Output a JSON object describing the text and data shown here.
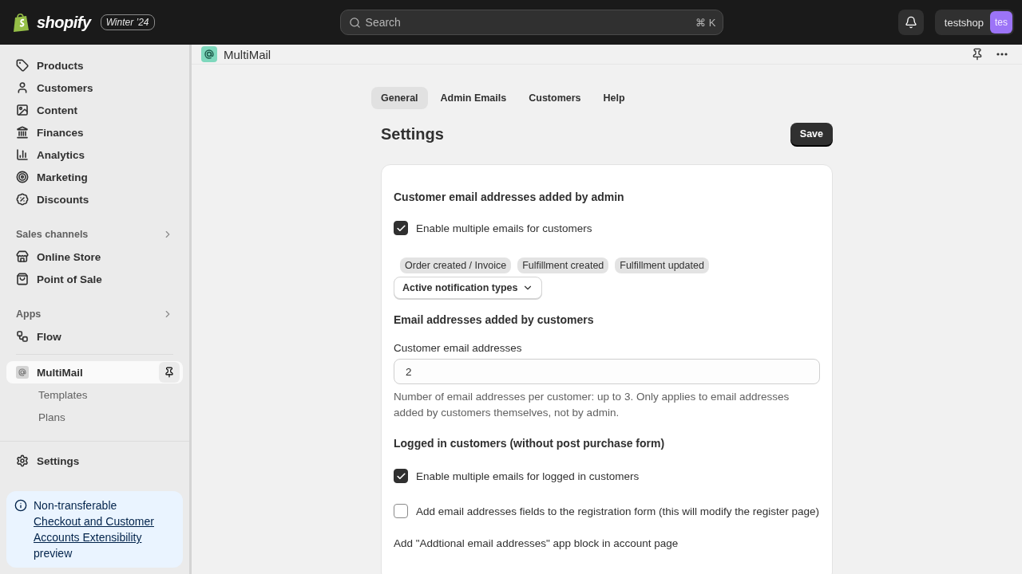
{
  "topbar": {
    "brand": "shopify",
    "edition": "Winter ’24",
    "search": {
      "placeholder": "Search",
      "shortcut": "⌘ K"
    },
    "store": {
      "name": "testshop",
      "avatar": "tes"
    }
  },
  "sidebar": {
    "nav_items": [
      {
        "label": "Products"
      },
      {
        "label": "Customers"
      },
      {
        "label": "Content"
      },
      {
        "label": "Finances"
      },
      {
        "label": "Analytics"
      },
      {
        "label": "Marketing"
      },
      {
        "label": "Discounts"
      }
    ],
    "sections": [
      {
        "title": "Sales channels",
        "items": [
          {
            "label": "Online Store"
          },
          {
            "label": "Point of Sale"
          }
        ]
      },
      {
        "title": "Apps",
        "items": [
          {
            "label": "Flow"
          }
        ]
      }
    ],
    "app": {
      "label": "MultiMail",
      "selected": true,
      "children": [
        {
          "label": "Templates",
          "selected": false
        },
        {
          "label": "Plans",
          "selected": false
        }
      ]
    },
    "settings": "Settings",
    "banner": {
      "text": "Non-transferable",
      "link": "Checkout and Customer Accounts Extensibility",
      "tail": "preview"
    }
  },
  "page_header": {
    "title": "MultiMail"
  },
  "tabs": [
    {
      "label": "General",
      "selected": true
    },
    {
      "label": "Admin Emails",
      "selected": false
    },
    {
      "label": "Customers",
      "selected": false
    },
    {
      "label": "Help",
      "selected": false
    }
  ],
  "title": "Settings",
  "save_button": "Save",
  "card": {
    "admin_heading": "Customer email addresses added by admin",
    "admin_checkbox": {
      "label": "Enable multiple emails for customers",
      "checked": true
    },
    "tags": [
      "Order created / Invoice",
      "Fulfillment created",
      "Fulfillment updated"
    ],
    "dropdown": "Active notification types",
    "customers_heading": "Email addresses added by customers",
    "field": {
      "label": "Customer email addresses",
      "value": "2",
      "help": "Number of email addresses per customer: up to 3. Only applies to email addresses added by customers themselves, not by admin."
    },
    "logged_heading": "Logged in customers (without post purchase form)",
    "checkboxes": [
      {
        "label": "Enable multiple emails for logged in customers",
        "checked": true
      },
      {
        "label": "Add email addresses fields to the registration form (this will modify the register page)",
        "checked": false
      }
    ],
    "footer_text": "Add \"Addtional email addresses\" app block in account page"
  }
}
